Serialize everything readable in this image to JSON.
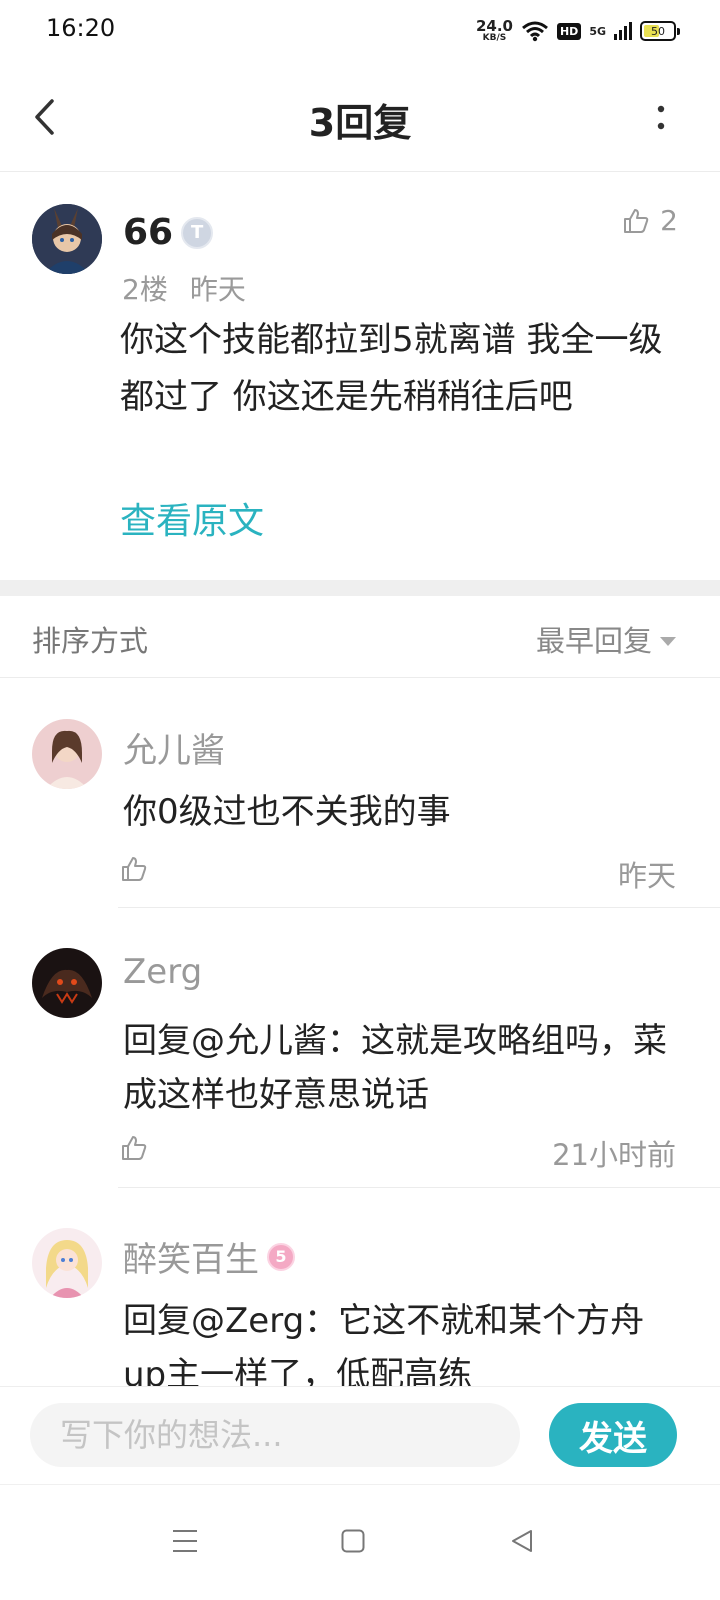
{
  "status_bar": {
    "time": "16:20",
    "net_speed": "24.0",
    "net_unit": "KB/S",
    "hd": "HD",
    "network": "5G",
    "battery": "50"
  },
  "header": {
    "title": "3回复"
  },
  "post": {
    "username": "66",
    "level_badge": "T",
    "like_count": "2",
    "floor": "2楼",
    "time": "昨天",
    "text": "你这个技能都拉到5就离谱 我全一级都过了 你这还是先稍稍往后吧",
    "view_original": "查看原文"
  },
  "sort": {
    "label": "排序方式",
    "selected": "最早回复"
  },
  "replies": [
    {
      "username": "允儿酱",
      "text": "你0级过也不关我的事",
      "time": "昨天"
    },
    {
      "username": "Zerg",
      "text": "回复@允儿酱：这就是攻略组吗，菜成这样也好意思说话",
      "time": "21小时前"
    },
    {
      "username": "醉笑百生",
      "badge": "5",
      "text": "回复@Zerg：它这不就和某个方舟up主一样了，低配高练"
    }
  ],
  "composer": {
    "placeholder": "写下你的想法...",
    "send_label": "发送"
  },
  "colors": {
    "accent": "#2ab3c0",
    "muted_text": "#999999"
  }
}
